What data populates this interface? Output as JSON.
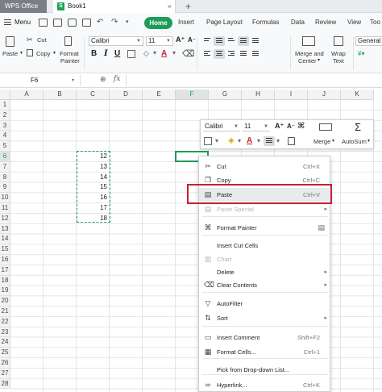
{
  "titlebar": {
    "app_tab": "WPS Office",
    "doc_tab": "Book1"
  },
  "menubar": {
    "menu_label": "Menu",
    "tabs": [
      "Home",
      "Insert",
      "Page Layout",
      "Formulas",
      "Data",
      "Review",
      "View",
      "Too"
    ]
  },
  "ribbon": {
    "cut": "Cut",
    "copy": "Copy",
    "paste": "Paste",
    "format_painter_1": "Format",
    "format_painter_2": "Painter",
    "font": "Calibri",
    "size": "11",
    "merge_1": "Merge and",
    "merge_2": "Center",
    "wrap_1": "Wrap",
    "wrap_2": "Text",
    "general": "General"
  },
  "formula_bar": {
    "cell_ref": "F6",
    "fx": "fx"
  },
  "grid": {
    "columns": [
      "A",
      "B",
      "C",
      "D",
      "E",
      "F",
      "G",
      "H",
      "I",
      "J",
      "K"
    ],
    "rows": [
      "1",
      "2",
      "3",
      "4",
      "5",
      "6",
      "7",
      "8",
      "9",
      "10",
      "11",
      "12",
      "13",
      "14",
      "15",
      "16",
      "17",
      "18",
      "19",
      "20",
      "21",
      "22",
      "23",
      "24",
      "25",
      "26",
      "27",
      "28"
    ],
    "selected_column": "F",
    "selected_row": "6",
    "column_c_values": [
      "12",
      "13",
      "14",
      "15",
      "16",
      "17",
      "18"
    ]
  },
  "mini_toolbar": {
    "font": "Calibri",
    "size": "11",
    "merge": "Merge",
    "autosum": "AutoSum"
  },
  "context_menu": {
    "items": [
      {
        "label": "Cut",
        "shortcut": "Ctrl+X",
        "icon": "scissors-icon"
      },
      {
        "label": "Copy",
        "shortcut": "Ctrl+C",
        "icon": "copy-icon"
      },
      {
        "label": "Paste",
        "shortcut": "Ctrl+V",
        "icon": "paste-icon"
      },
      {
        "label": "Paste Special",
        "shortcut": "",
        "icon": "paste-special-icon"
      },
      {
        "label": "Format Painter",
        "shortcut": "",
        "icon": "brush-icon"
      },
      {
        "label": "Insert Cut Cells",
        "shortcut": "",
        "icon": ""
      },
      {
        "label": "Chart",
        "shortcut": "",
        "icon": "chart-icon"
      },
      {
        "label": "Delete",
        "shortcut": "",
        "icon": ""
      },
      {
        "label": "Clear Contents",
        "shortcut": "",
        "icon": "eraser-icon"
      },
      {
        "label": "AutoFilter",
        "shortcut": "",
        "icon": "filter-icon"
      },
      {
        "label": "Sort",
        "shortcut": "",
        "icon": "sort-icon"
      },
      {
        "label": "Insert Comment",
        "shortcut": "Shift+F2",
        "icon": "comment-icon"
      },
      {
        "label": "Format Cells...",
        "shortcut": "Ctrl+1",
        "icon": "format-cells-icon"
      },
      {
        "label": "Pick from Drop-down List...",
        "shortcut": "",
        "icon": ""
      },
      {
        "label": "Hyperlink...",
        "shortcut": "Ctrl+K",
        "icon": "link-icon"
      }
    ]
  },
  "colors": {
    "accent": "#1f9c57",
    "highlight_box": "#c8202e"
  }
}
